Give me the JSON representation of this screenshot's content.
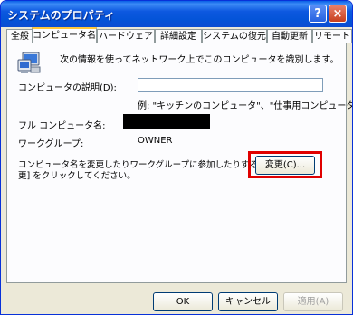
{
  "window": {
    "title": "システムのプロパティ",
    "help_label": "?",
    "close_label": "×"
  },
  "tabs": [
    {
      "label": "全般"
    },
    {
      "label": "コンピュータ名"
    },
    {
      "label": "ハードウェア"
    },
    {
      "label": "詳細設定"
    },
    {
      "label": "システムの復元"
    },
    {
      "label": "自動更新"
    },
    {
      "label": "リモート"
    }
  ],
  "active_tab": "コンピュータ名",
  "content": {
    "intro": "次の情報を使ってネットワーク上でこのコンピュータを識別します。",
    "description_label": "コンピュータの説明(D):",
    "description_value": "",
    "example": "例: \"キッチンのコンピュータ\"、\"仕事用コンピュータ\"",
    "full_name_label": "フル コンピュータ名:",
    "workgroup_label": "ワークグループ:",
    "workgroup_value": "OWNER",
    "change_hint_line1": "コンピュータ名を変更したりワークグループに参加したりするには [変",
    "change_hint_line2": "更] をクリックしてください。",
    "change_button": "変更(C)..."
  },
  "footer": {
    "ok": "OK",
    "cancel": "キャンセル",
    "apply": "適用(A)"
  },
  "colors": {
    "highlight": "#e00000",
    "titlebar": "#0454d8",
    "tab_active_accent": "#ffc73c"
  }
}
